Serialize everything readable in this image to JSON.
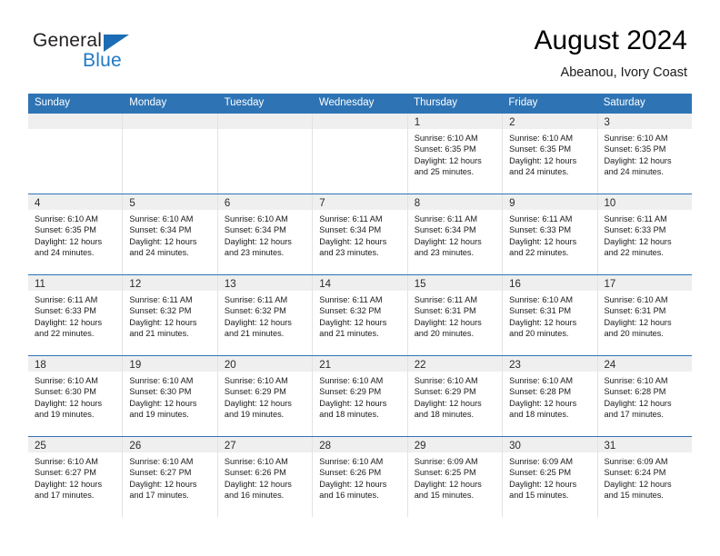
{
  "brand": {
    "name_part1": "General",
    "name_part2": "Blue",
    "color_black": "#231f20",
    "color_blue": "#2079c6",
    "triangle_color": "#1c6cb5"
  },
  "header": {
    "title": "August 2024",
    "subtitle": "Abeanou, Ivory Coast"
  },
  "theme": {
    "header_row_bg": "#2e74b5",
    "daynum_bar_bg": "#efefef",
    "cell_border": "#e3e3e3"
  },
  "weekdays": [
    "Sunday",
    "Monday",
    "Tuesday",
    "Wednesday",
    "Thursday",
    "Friday",
    "Saturday"
  ],
  "weeks": [
    [
      {
        "day": "",
        "lines": []
      },
      {
        "day": "",
        "lines": []
      },
      {
        "day": "",
        "lines": []
      },
      {
        "day": "",
        "lines": []
      },
      {
        "day": "1",
        "lines": [
          "Sunrise: 6:10 AM",
          "Sunset: 6:35 PM",
          "Daylight: 12 hours",
          "and 25 minutes."
        ]
      },
      {
        "day": "2",
        "lines": [
          "Sunrise: 6:10 AM",
          "Sunset: 6:35 PM",
          "Daylight: 12 hours",
          "and 24 minutes."
        ]
      },
      {
        "day": "3",
        "lines": [
          "Sunrise: 6:10 AM",
          "Sunset: 6:35 PM",
          "Daylight: 12 hours",
          "and 24 minutes."
        ]
      }
    ],
    [
      {
        "day": "4",
        "lines": [
          "Sunrise: 6:10 AM",
          "Sunset: 6:35 PM",
          "Daylight: 12 hours",
          "and 24 minutes."
        ]
      },
      {
        "day": "5",
        "lines": [
          "Sunrise: 6:10 AM",
          "Sunset: 6:34 PM",
          "Daylight: 12 hours",
          "and 24 minutes."
        ]
      },
      {
        "day": "6",
        "lines": [
          "Sunrise: 6:10 AM",
          "Sunset: 6:34 PM",
          "Daylight: 12 hours",
          "and 23 minutes."
        ]
      },
      {
        "day": "7",
        "lines": [
          "Sunrise: 6:11 AM",
          "Sunset: 6:34 PM",
          "Daylight: 12 hours",
          "and 23 minutes."
        ]
      },
      {
        "day": "8",
        "lines": [
          "Sunrise: 6:11 AM",
          "Sunset: 6:34 PM",
          "Daylight: 12 hours",
          "and 23 minutes."
        ]
      },
      {
        "day": "9",
        "lines": [
          "Sunrise: 6:11 AM",
          "Sunset: 6:33 PM",
          "Daylight: 12 hours",
          "and 22 minutes."
        ]
      },
      {
        "day": "10",
        "lines": [
          "Sunrise: 6:11 AM",
          "Sunset: 6:33 PM",
          "Daylight: 12 hours",
          "and 22 minutes."
        ]
      }
    ],
    [
      {
        "day": "11",
        "lines": [
          "Sunrise: 6:11 AM",
          "Sunset: 6:33 PM",
          "Daylight: 12 hours",
          "and 22 minutes."
        ]
      },
      {
        "day": "12",
        "lines": [
          "Sunrise: 6:11 AM",
          "Sunset: 6:32 PM",
          "Daylight: 12 hours",
          "and 21 minutes."
        ]
      },
      {
        "day": "13",
        "lines": [
          "Sunrise: 6:11 AM",
          "Sunset: 6:32 PM",
          "Daylight: 12 hours",
          "and 21 minutes."
        ]
      },
      {
        "day": "14",
        "lines": [
          "Sunrise: 6:11 AM",
          "Sunset: 6:32 PM",
          "Daylight: 12 hours",
          "and 21 minutes."
        ]
      },
      {
        "day": "15",
        "lines": [
          "Sunrise: 6:11 AM",
          "Sunset: 6:31 PM",
          "Daylight: 12 hours",
          "and 20 minutes."
        ]
      },
      {
        "day": "16",
        "lines": [
          "Sunrise: 6:10 AM",
          "Sunset: 6:31 PM",
          "Daylight: 12 hours",
          "and 20 minutes."
        ]
      },
      {
        "day": "17",
        "lines": [
          "Sunrise: 6:10 AM",
          "Sunset: 6:31 PM",
          "Daylight: 12 hours",
          "and 20 minutes."
        ]
      }
    ],
    [
      {
        "day": "18",
        "lines": [
          "Sunrise: 6:10 AM",
          "Sunset: 6:30 PM",
          "Daylight: 12 hours",
          "and 19 minutes."
        ]
      },
      {
        "day": "19",
        "lines": [
          "Sunrise: 6:10 AM",
          "Sunset: 6:30 PM",
          "Daylight: 12 hours",
          "and 19 minutes."
        ]
      },
      {
        "day": "20",
        "lines": [
          "Sunrise: 6:10 AM",
          "Sunset: 6:29 PM",
          "Daylight: 12 hours",
          "and 19 minutes."
        ]
      },
      {
        "day": "21",
        "lines": [
          "Sunrise: 6:10 AM",
          "Sunset: 6:29 PM",
          "Daylight: 12 hours",
          "and 18 minutes."
        ]
      },
      {
        "day": "22",
        "lines": [
          "Sunrise: 6:10 AM",
          "Sunset: 6:29 PM",
          "Daylight: 12 hours",
          "and 18 minutes."
        ]
      },
      {
        "day": "23",
        "lines": [
          "Sunrise: 6:10 AM",
          "Sunset: 6:28 PM",
          "Daylight: 12 hours",
          "and 18 minutes."
        ]
      },
      {
        "day": "24",
        "lines": [
          "Sunrise: 6:10 AM",
          "Sunset: 6:28 PM",
          "Daylight: 12 hours",
          "and 17 minutes."
        ]
      }
    ],
    [
      {
        "day": "25",
        "lines": [
          "Sunrise: 6:10 AM",
          "Sunset: 6:27 PM",
          "Daylight: 12 hours",
          "and 17 minutes."
        ]
      },
      {
        "day": "26",
        "lines": [
          "Sunrise: 6:10 AM",
          "Sunset: 6:27 PM",
          "Daylight: 12 hours",
          "and 17 minutes."
        ]
      },
      {
        "day": "27",
        "lines": [
          "Sunrise: 6:10 AM",
          "Sunset: 6:26 PM",
          "Daylight: 12 hours",
          "and 16 minutes."
        ]
      },
      {
        "day": "28",
        "lines": [
          "Sunrise: 6:10 AM",
          "Sunset: 6:26 PM",
          "Daylight: 12 hours",
          "and 16 minutes."
        ]
      },
      {
        "day": "29",
        "lines": [
          "Sunrise: 6:09 AM",
          "Sunset: 6:25 PM",
          "Daylight: 12 hours",
          "and 15 minutes."
        ]
      },
      {
        "day": "30",
        "lines": [
          "Sunrise: 6:09 AM",
          "Sunset: 6:25 PM",
          "Daylight: 12 hours",
          "and 15 minutes."
        ]
      },
      {
        "day": "31",
        "lines": [
          "Sunrise: 6:09 AM",
          "Sunset: 6:24 PM",
          "Daylight: 12 hours",
          "and 15 minutes."
        ]
      }
    ]
  ]
}
